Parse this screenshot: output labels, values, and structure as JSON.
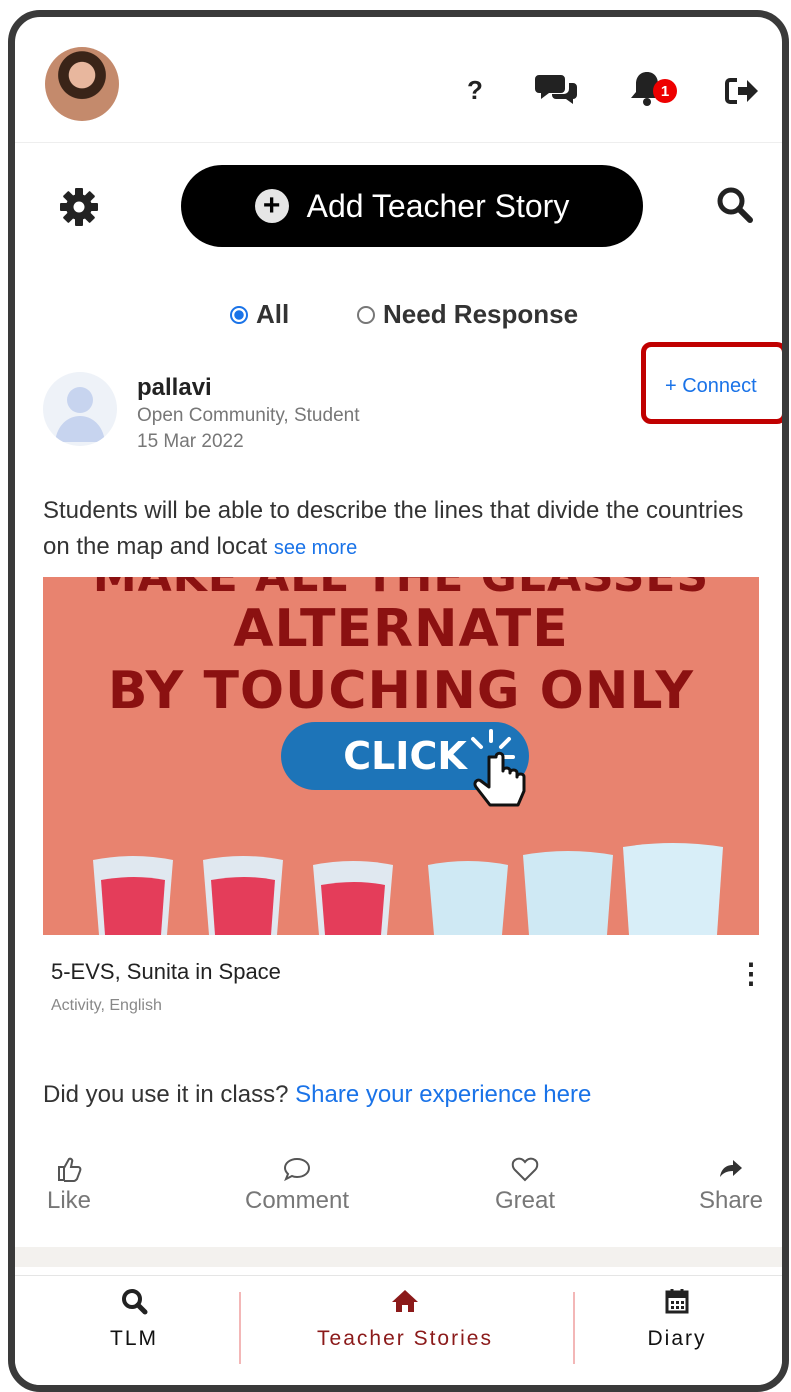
{
  "header": {
    "help_label": "?",
    "notification_count": "1"
  },
  "toolbar": {
    "add_story_label": "Add Teacher Story"
  },
  "filters": {
    "all_label": "All",
    "need_response_label": "Need Response",
    "selected": "All"
  },
  "post": {
    "author": "pallavi",
    "author_meta": "Open Community, Student",
    "date": "15 Mar 2022",
    "connect_label": "+ Connect",
    "description": "Students will be able to describe the lines that divide the countries on the map and locat",
    "see_more_label": "see more",
    "media": {
      "line_top": "MAKE ALL THE GLASSES",
      "line1": "ALTERNATE",
      "line2": "BY TOUCHING ONLY ONE",
      "button": "CLICK"
    },
    "caption": "5-EVS, Sunita in Space",
    "subcaption": "Activity, English",
    "question": "Did you use it in class?",
    "share_experience_label": "Share your experience here",
    "actions": {
      "like": "Like",
      "comment": "Comment",
      "great": "Great",
      "share": "Share"
    }
  },
  "bottom_nav": {
    "tlm": "TLM",
    "teacher_stories": "Teacher Stories",
    "diary": "Diary",
    "active_color": "#8b1a1a"
  },
  "colors": {
    "accent_blue": "#1a73e8",
    "highlight_red": "#c00000",
    "media_bg": "#e8836f"
  }
}
